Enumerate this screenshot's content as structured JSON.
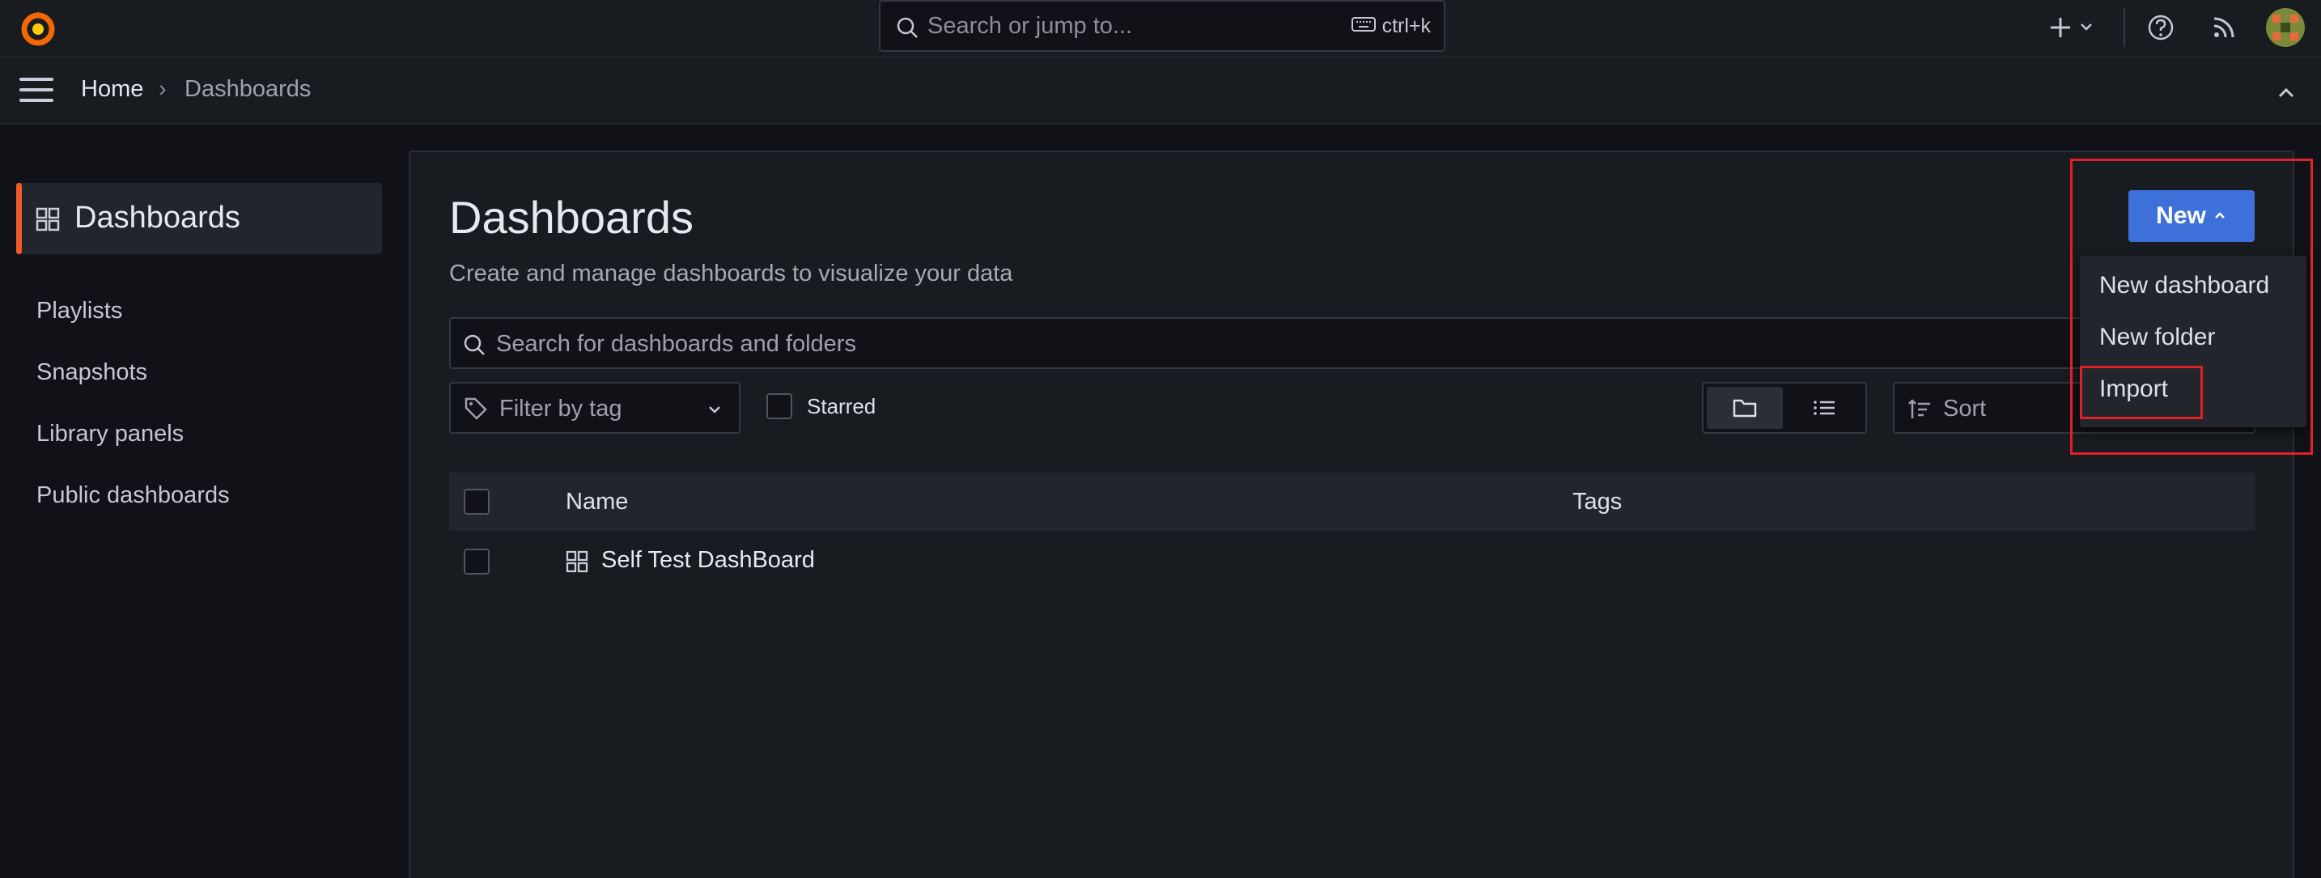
{
  "topbar": {
    "search_placeholder": "Search or jump to...",
    "shortcut": "ctrl+k"
  },
  "breadcrumb": {
    "home": "Home",
    "separator": "›",
    "current": "Dashboards"
  },
  "sidebar": {
    "active": "Dashboards",
    "items": [
      {
        "label": "Playlists"
      },
      {
        "label": "Snapshots"
      },
      {
        "label": "Library panels"
      },
      {
        "label": "Public dashboards"
      }
    ]
  },
  "page": {
    "title": "Dashboards",
    "subtitle": "Create and manage dashboards to visualize your data",
    "search_placeholder": "Search for dashboards and folders",
    "tag_filter_placeholder": "Filter by tag",
    "starred_label": "Starred",
    "sort_placeholder": "Sort"
  },
  "new_button": {
    "label": "New",
    "menu": [
      {
        "label": "New dashboard"
      },
      {
        "label": "New folder"
      },
      {
        "label": "Import"
      }
    ]
  },
  "table": {
    "columns": [
      "Name",
      "Tags"
    ],
    "rows": [
      {
        "name": "Self Test DashBoard",
        "tags": ""
      }
    ]
  },
  "colors": {
    "accent_orange": "#f05a28",
    "primary_blue": "#3d71d9",
    "highlight_red": "#e0202a"
  }
}
